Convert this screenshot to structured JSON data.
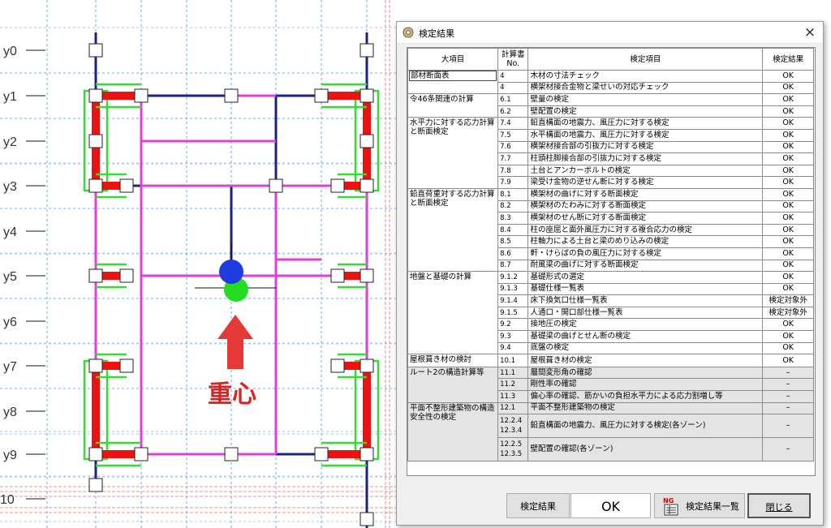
{
  "plan": {
    "axis_labels": [
      "y0",
      "y1",
      "y2",
      "y3",
      "y4",
      "y5",
      "y6",
      "y7",
      "y8",
      "y9",
      "10"
    ],
    "cog_label": "重心",
    "colors": {
      "beam_navy": "#1a237e",
      "beam_magenta": "#e040d8",
      "wall_red": "#ee1111",
      "wall_green": "#33dd33",
      "grid_blue": "#5b8fd6",
      "grid_red": "#e07070",
      "marker_blue": "#1e3ce0",
      "marker_green": "#22dd22",
      "arrow": "#e53935"
    }
  },
  "dialog": {
    "title": "検定結果",
    "title_icon": "app-gear-icon",
    "close_label": "×",
    "headers": {
      "category": "大項目",
      "calc_no": "計算書 No.",
      "item": "検定項目",
      "result": "検定結果"
    },
    "groups": [
      {
        "category": "部材断面表",
        "rows": [
          {
            "no": "4",
            "item": "木材の寸法チェック",
            "result": "OK"
          },
          {
            "no": "4",
            "item": "横架材接合金物と梁せいの対応チェック",
            "result": "OK"
          }
        ]
      },
      {
        "category": "令46条関連の計算",
        "rows": [
          {
            "no": "6.1",
            "item": "壁量の検定",
            "result": "OK"
          },
          {
            "no": "6.2",
            "item": "壁配置の検定",
            "result": "OK"
          }
        ]
      },
      {
        "category": "水平力に対する応力計算と断面検定",
        "rows": [
          {
            "no": "7.4",
            "item": "鉛直構面の地震力、風圧力に対する検定",
            "result": "OK"
          },
          {
            "no": "7.5",
            "item": "水平構面の地震力、風圧力に対する検定",
            "result": "OK"
          },
          {
            "no": "7.6",
            "item": "横架材接合部の引抜力に対する検定",
            "result": "OK"
          },
          {
            "no": "7.7",
            "item": "柱頭柱脚接合部の引抜力に対する検定",
            "result": "OK"
          },
          {
            "no": "7.8",
            "item": "土台とアンカーボルトの検定",
            "result": "OK"
          },
          {
            "no": "7.9",
            "item": "梁受け金物の逆せん断に対する検定",
            "result": "OK"
          }
        ]
      },
      {
        "category": "鉛直荷重対する応力計算と断面検定",
        "rows": [
          {
            "no": "8.1",
            "item": "横架材の曲げに対する断面検定",
            "result": "OK"
          },
          {
            "no": "8.2",
            "item": "横架材のたわみに対する断面検定",
            "result": "OK"
          },
          {
            "no": "8.3",
            "item": "横架材のせん断に対する断面検定",
            "result": "OK"
          },
          {
            "no": "8.4",
            "item": "柱の座屈と面外風圧力に対する複合応力の検定",
            "result": "OK"
          },
          {
            "no": "8.5",
            "item": "柱軸力による土台と梁のめり込みの検定",
            "result": "OK"
          },
          {
            "no": "8.6",
            "item": "軒・けらばの負の風圧力に対する検定",
            "result": "OK"
          },
          {
            "no": "8.7",
            "item": "耐風梁の曲げに対する断面検定",
            "result": "OK"
          }
        ]
      },
      {
        "category": "地盤と基礎の計算",
        "rows": [
          {
            "no": "9.1.2",
            "item": "基礎形式の選定",
            "result": "OK"
          },
          {
            "no": "9.1.3",
            "item": "基礎仕様一覧表",
            "result": "OK"
          },
          {
            "no": "9.1.4",
            "item": "床下換気口仕様一覧表",
            "result": "検定対象外"
          },
          {
            "no": "9.1.5",
            "item": "人通口・開口部仕様一覧表",
            "result": "検定対象外"
          },
          {
            "no": "9.2",
            "item": "接地圧の検定",
            "result": "OK"
          },
          {
            "no": "9.3",
            "item": "基礎梁の曲げとせん断の検定",
            "result": "OK"
          },
          {
            "no": "9.4",
            "item": "底盤の検定",
            "result": "OK"
          }
        ]
      },
      {
        "category": "屋根葺き材の検討",
        "rows": [
          {
            "no": "10.1",
            "item": "屋根葺き材の検定",
            "result": "OK"
          }
        ]
      },
      {
        "category": "ルート2の構造計算等",
        "gray": true,
        "rows": [
          {
            "no": "11.1",
            "item": "層間変形角の確認",
            "result": "–"
          },
          {
            "no": "11.2",
            "item": "剛性率の確認",
            "result": "–"
          },
          {
            "no": "11.3",
            "item": "偏心率の確認、筋かいの負担水平力による応力割増し等",
            "result": "–"
          }
        ]
      },
      {
        "category": "平面不整形建築物の構造安全性の検定",
        "gray": true,
        "rows": [
          {
            "no": "12.1",
            "item": "平面不整形建築物の検定",
            "result": "–"
          },
          {
            "no": "12.2.4 12.3.4",
            "item": "鉛直構面の地震力、風圧力に対する検定(各ゾーン)",
            "result": "–",
            "tall": true
          },
          {
            "no": "12.2.5 12.3.5",
            "item": "壁配置の確認(各ゾーン)",
            "result": "–",
            "tall": true
          }
        ]
      }
    ],
    "buttons": {
      "result": "検定結果",
      "ok": "OK",
      "ng_badge": "NG",
      "ng_list": "検定結果一覧",
      "close": "閉じる"
    }
  }
}
